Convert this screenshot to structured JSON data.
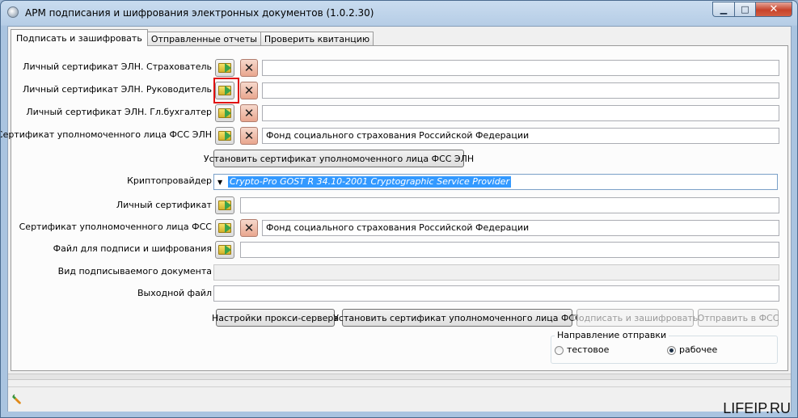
{
  "window": {
    "title": "АРМ подписания и шифрования электронных документов (1.0.2.30)",
    "min_glyph": "▁",
    "max_glyph": "□",
    "close_glyph": "✕"
  },
  "tabs": [
    {
      "label": "Подписать и зашифровать",
      "active": true
    },
    {
      "label": "Отправленные отчеты",
      "active": false
    },
    {
      "label": "Проверить квитанцию",
      "active": false
    }
  ],
  "form": {
    "rows": [
      {
        "label": "Личный сертификат ЭЛН. Страхователь",
        "value": ""
      },
      {
        "label": "Личный сертификат ЭЛН. Руководитель",
        "value": ""
      },
      {
        "label": "Личный сертификат ЭЛН. Гл.бухгалтер",
        "value": ""
      },
      {
        "label": "Сертификат уполномоченного лица ФСС ЭЛН",
        "value": "Фонд социального страхования Российской Федерации"
      }
    ],
    "install_fss_eln_button": "Установить сертификат уполномоченного лица ФСС ЭЛН",
    "crypto_provider": {
      "label": "Криптопровайдер",
      "selected": "Crypto-Pro GOST R 34.10-2001 Cryptographic Service Provider"
    },
    "personal_cert": {
      "label": "Личный сертификат",
      "value": ""
    },
    "fss_cert": {
      "label": "Сертификат уполномоченного лица ФСС",
      "value": "Фонд социального страхования Российской Федерации"
    },
    "sign_file": {
      "label": "Файл для подписи и шифрования",
      "value": ""
    },
    "doc_type": {
      "label": "Вид подписываемого документа",
      "value": ""
    },
    "output_file": {
      "label": "Выходной файл",
      "value": ""
    }
  },
  "buttons": {
    "proxy": "Настройки прокси-сервера",
    "install_fss": "Установить сертификат уполномоченного лица ФСС",
    "sign_encrypt": "Подписать и зашифровать",
    "send_fss": "Отправить в ФСС"
  },
  "direction": {
    "title": "Направление отправки",
    "test": "тестовое",
    "work": "рабочее",
    "selected": "рабочее"
  },
  "icons": {
    "open": "folder-arrow-icon",
    "delete": "delete-x-icon",
    "status": "pencil-carrot-icon"
  },
  "watermark": "LIFEIP.RU",
  "colors": {
    "selection": "#3399ff",
    "highlight": "#e01010"
  }
}
